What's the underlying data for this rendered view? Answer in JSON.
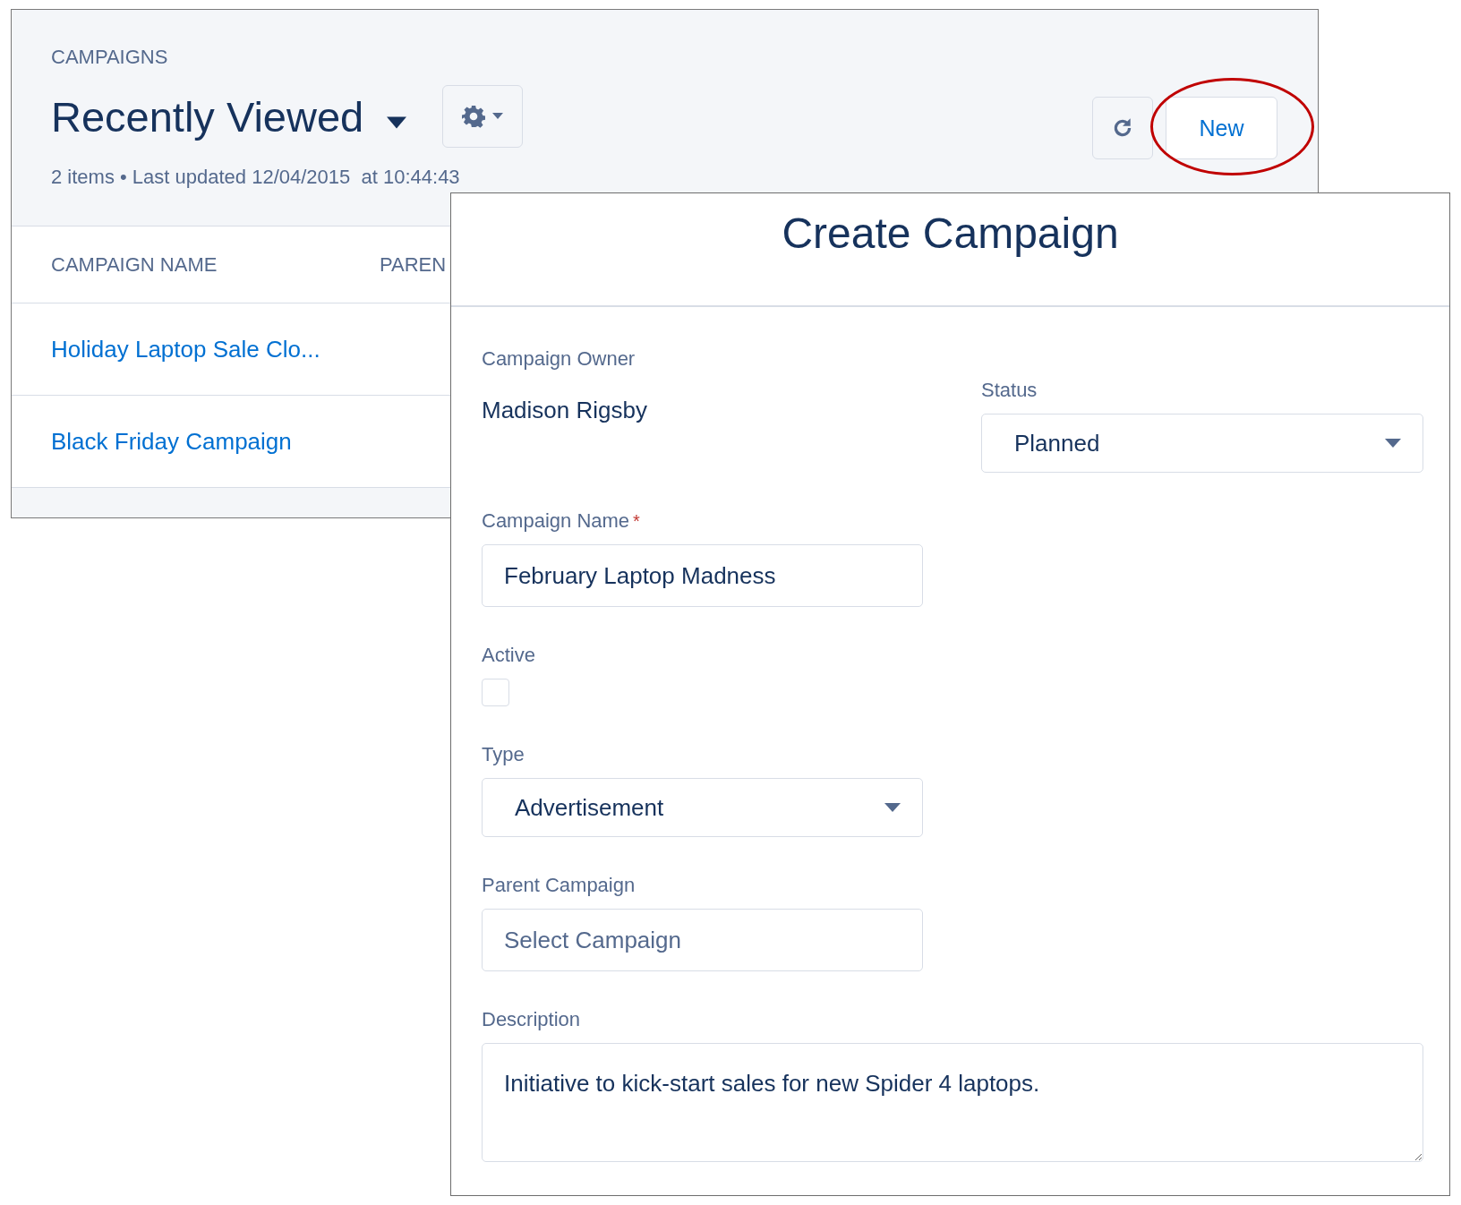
{
  "list_view": {
    "object_label": "CAMPAIGNS",
    "view_name": "Recently Viewed",
    "status_text": "2 items • Last updated 12/04/2015  at 10:44:43",
    "new_button": "New",
    "columns": [
      "CAMPAIGN NAME",
      "PAREN"
    ],
    "rows": [
      {
        "name": "Holiday Laptop Sale Clo..."
      },
      {
        "name": "Black Friday Campaign"
      }
    ]
  },
  "dialog": {
    "title": "Create Campaign",
    "fields": [
      {
        "kind": "readonly",
        "label": "Campaign Owner",
        "value": "Madison Rigsby"
      },
      {
        "kind": "select",
        "label": "Status",
        "value": "Planned"
      },
      {
        "kind": "text",
        "label": "Campaign Name",
        "value": "February Laptop Madness",
        "required_mark": "*"
      },
      {
        "kind": "checkbox",
        "label": "Active",
        "checked": false
      },
      {
        "kind": "select",
        "label": "Type",
        "value": "Advertisement"
      },
      {
        "kind": "lookup",
        "label": "Parent Campaign",
        "placeholder": "Select Campaign"
      },
      {
        "kind": "textarea",
        "label": "Description",
        "value": "Initiative to kick-start sales for new Spider 4 laptops."
      }
    ]
  }
}
